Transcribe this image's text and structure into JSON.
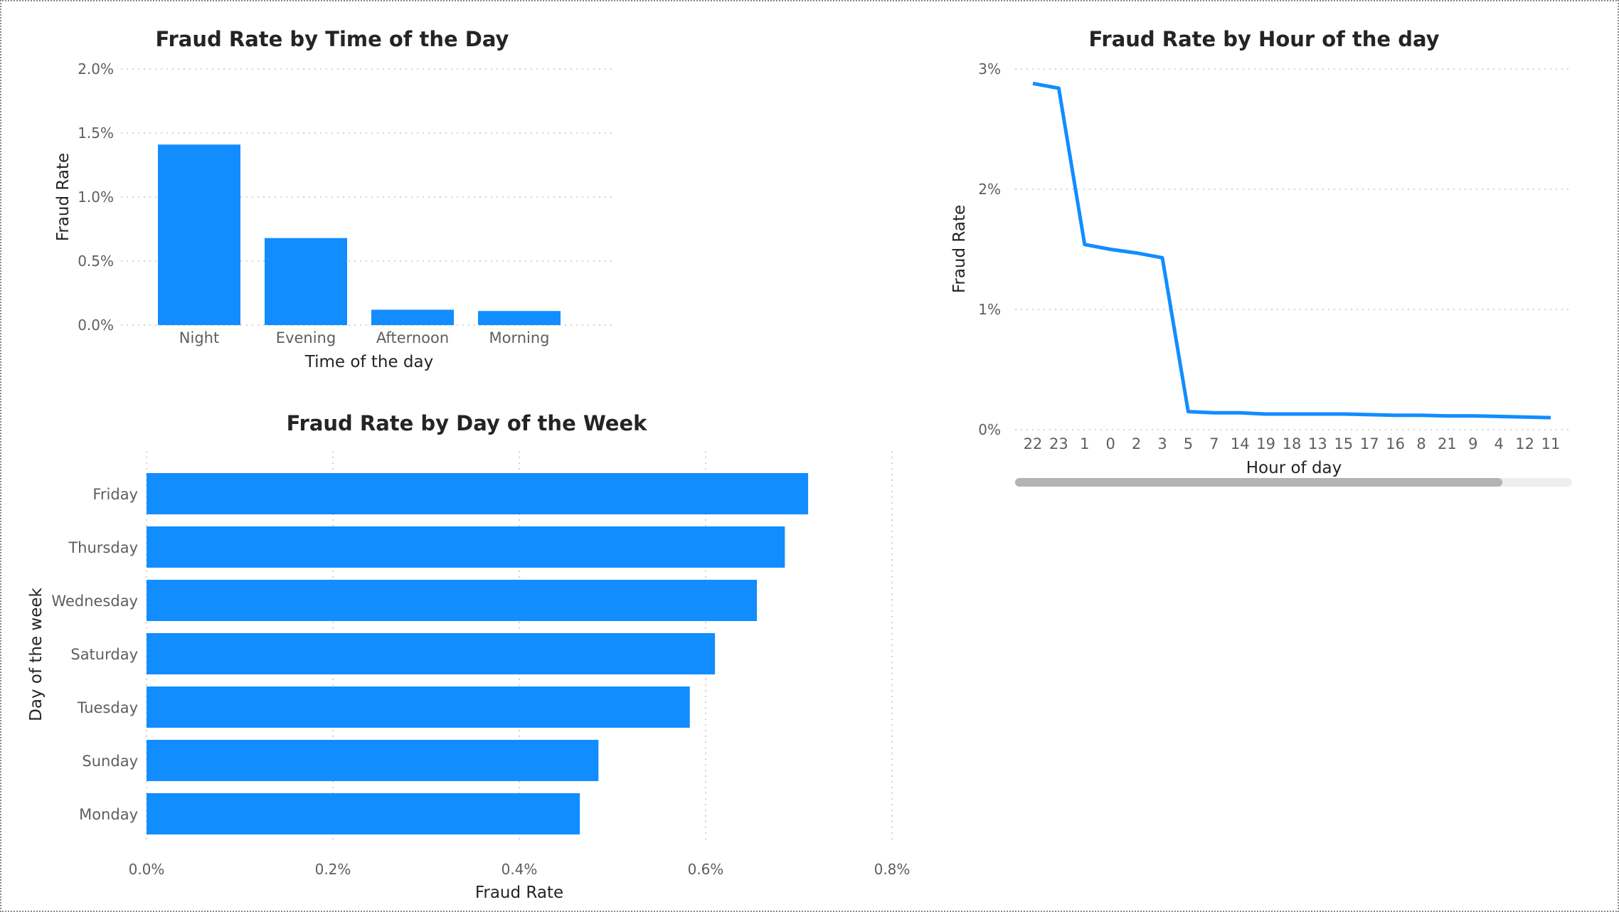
{
  "chart_data": [
    {
      "type": "bar",
      "title": "Fraud Rate by Time of the Day",
      "xlabel": "Time of the day",
      "ylabel": "Fraud Rate",
      "categories": [
        "Night",
        "Evening",
        "Afternoon",
        "Morning"
      ],
      "values": [
        1.41,
        0.68,
        0.12,
        0.11
      ],
      "value_unit": "%",
      "ylim": [
        0,
        2.0
      ],
      "yticks": [
        "0.0%",
        "0.5%",
        "1.0%",
        "1.5%",
        "2.0%"
      ],
      "grid": true,
      "color": "#118dff"
    },
    {
      "type": "bar",
      "orientation": "horizontal",
      "title": "Fraud Rate by Day of the Week",
      "xlabel": "Fraud Rate",
      "ylabel": "Day of the week",
      "categories": [
        "Friday",
        "Thursday",
        "Wednesday",
        "Saturday",
        "Tuesday",
        "Sunday",
        "Monday"
      ],
      "values": [
        0.71,
        0.685,
        0.655,
        0.61,
        0.583,
        0.485,
        0.465
      ],
      "value_unit": "%",
      "xlim": [
        0,
        0.8
      ],
      "xticks": [
        "0.0%",
        "0.2%",
        "0.4%",
        "0.6%",
        "0.8%"
      ],
      "grid": true,
      "color": "#118dff"
    },
    {
      "type": "line",
      "title": "Fraud Rate by Hour of the day",
      "xlabel": "Hour of day",
      "ylabel": "Fraud Rate",
      "x": [
        "22",
        "23",
        "1",
        "0",
        "2",
        "3",
        "5",
        "7",
        "14",
        "19",
        "18",
        "13",
        "15",
        "17",
        "16",
        "8",
        "21",
        "9",
        "4",
        "12",
        "11"
      ],
      "values": [
        2.88,
        2.84,
        1.54,
        1.5,
        1.47,
        1.43,
        0.15,
        0.14,
        0.14,
        0.13,
        0.13,
        0.13,
        0.13,
        0.125,
        0.12,
        0.12,
        0.115,
        0.115,
        0.11,
        0.105,
        0.1
      ],
      "value_unit": "%",
      "ylim": [
        0,
        3
      ],
      "yticks": [
        "0%",
        "1%",
        "2%",
        "3%"
      ],
      "grid": true,
      "color": "#118dff",
      "scrollbar": {
        "visible_fraction": 0.875
      }
    }
  ]
}
